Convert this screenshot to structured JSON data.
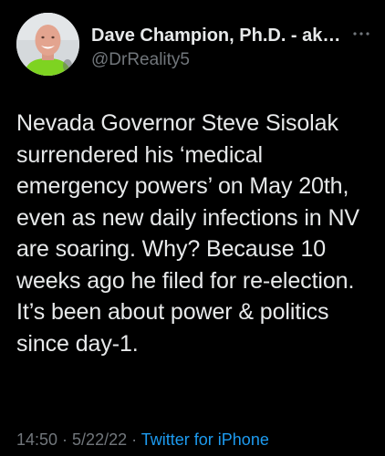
{
  "author": {
    "display_name": "Dave Champion, Ph.D. - ak…",
    "handle": "@DrReality5"
  },
  "icons": {
    "avatar": "profile-photo",
    "more": "more-horizontal-icon"
  },
  "tweet": {
    "text": "Nevada Governor Steve Sisolak surrendered his ‘medical emergency powers’ on May 20th, even as new daily infections in NV are soaring. Why? Because 10 weeks ago he filed for re-election.\nIt’s been about power & politics since day-1."
  },
  "meta": {
    "time": "14:50",
    "separator_1": " · ",
    "date": "5/22/22",
    "separator_2": " · ",
    "source": "Twitter for iPhone"
  },
  "colors": {
    "background": "#000000",
    "text": "#e7e9ea",
    "secondary": "#71767b",
    "link": "#1d9bf0"
  }
}
